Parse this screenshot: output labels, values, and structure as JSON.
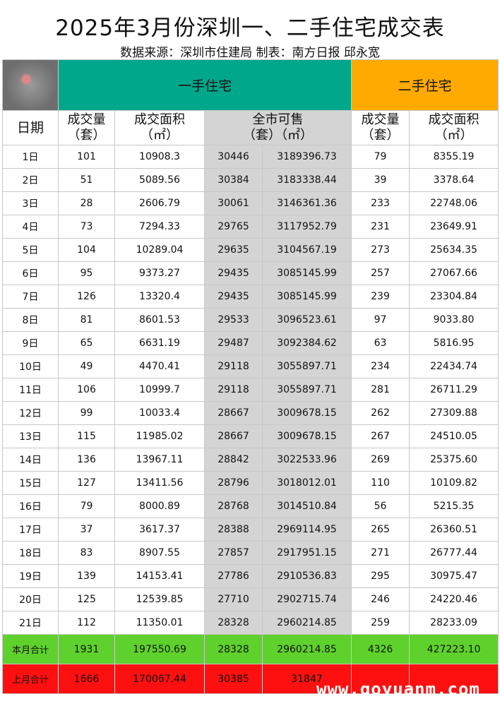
{
  "title": "2025年3月份深圳一、二手住宅成交表",
  "subtitle": "数据来源：深圳市住建局 制表：南方日报 邱永宽",
  "band": {
    "first_hand": "一手住宅",
    "second_hand": "二手住宅"
  },
  "headers": {
    "date": "日期",
    "fh_count": "成交量\n（套）",
    "fh_area": "成交面积\n（㎡）",
    "available_title": "全市可售",
    "available_units": "（套）（㎡）",
    "sh_count": "成交量\n（套）",
    "sh_area": "成交面积\n（㎡）"
  },
  "rows": [
    [
      "1日",
      "101",
      "10908.3",
      "30446",
      "3189396.73",
      "79",
      "8355.19"
    ],
    [
      "2日",
      "51",
      "5089.56",
      "30384",
      "3183338.44",
      "39",
      "3378.64"
    ],
    [
      "3日",
      "28",
      "2606.79",
      "30061",
      "3146361.36",
      "233",
      "22748.06"
    ],
    [
      "4日",
      "73",
      "7294.33",
      "29765",
      "3117952.79",
      "231",
      "23649.91"
    ],
    [
      "5日",
      "104",
      "10289.04",
      "29635",
      "3104567.19",
      "273",
      "25634.35"
    ],
    [
      "6日",
      "95",
      "9373.27",
      "29435",
      "3085145.99",
      "257",
      "27067.66"
    ],
    [
      "7日",
      "126",
      "13320.4",
      "29435",
      "3085145.99",
      "239",
      "23304.84"
    ],
    [
      "8日",
      "81",
      "8601.53",
      "29533",
      "3096523.61",
      "97",
      "9033.80"
    ],
    [
      "9日",
      "65",
      "6631.19",
      "29487",
      "3092384.62",
      "63",
      "5816.95"
    ],
    [
      "10日",
      "49",
      "4470.41",
      "29118",
      "3055897.71",
      "234",
      "22434.74"
    ],
    [
      "11日",
      "106",
      "10999.7",
      "29118",
      "3055897.71",
      "281",
      "26711.29"
    ],
    [
      "12日",
      "99",
      "10033.4",
      "28667",
      "3009678.15",
      "262",
      "27309.88"
    ],
    [
      "13日",
      "115",
      "11985.02",
      "28667",
      "3009678.15",
      "267",
      "24510.05"
    ],
    [
      "14日",
      "136",
      "13967.11",
      "28842",
      "3022533.96",
      "269",
      "25375.60"
    ],
    [
      "15日",
      "127",
      "13411.56",
      "28796",
      "3018012.01",
      "110",
      "10109.82"
    ],
    [
      "16日",
      "79",
      "8000.89",
      "28768",
      "3014510.84",
      "56",
      "5215.35"
    ],
    [
      "17日",
      "37",
      "3617.37",
      "28388",
      "2969114.95",
      "265",
      "26360.51"
    ],
    [
      "18日",
      "83",
      "8907.55",
      "27857",
      "2917951.15",
      "271",
      "26777.44"
    ],
    [
      "19日",
      "139",
      "14153.41",
      "27786",
      "2910536.83",
      "295",
      "30975.47"
    ],
    [
      "20日",
      "125",
      "12539.85",
      "27710",
      "2902715.74",
      "246",
      "24220.46"
    ],
    [
      "21日",
      "112",
      "11350.01",
      "28328",
      "2960214.85",
      "259",
      "28233.09"
    ]
  ],
  "summary_current": [
    "本月合计",
    "1931",
    "197550.69",
    "28328",
    "2960214.85",
    "4326",
    "427223.10"
  ],
  "summary_previous": [
    "上月合计",
    "1666",
    "170067.44",
    "30385",
    "31847",
    "",
    ""
  ],
  "watermark": "www.goyuanm.com"
}
